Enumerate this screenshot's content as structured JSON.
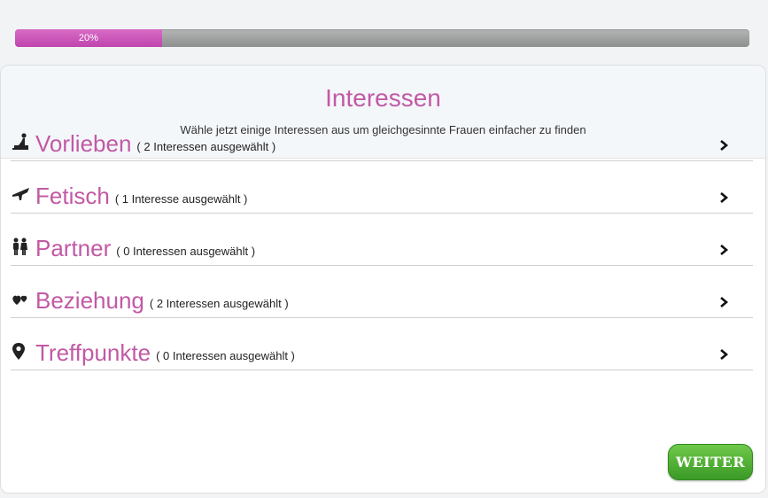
{
  "progress": {
    "value": 0.2,
    "label": "20%",
    "color": "#c655b4"
  },
  "header": {
    "title": "Interessen",
    "subtitle": "Wähle jetzt einige Interessen aus um gleichgesinnte Frauen einfacher zu finden"
  },
  "categories": [
    {
      "icon": "figure-icon",
      "title": "Vorlieben",
      "count": "( 2 Interessen ausgewählt )"
    },
    {
      "icon": "boot-icon",
      "title": "Fetisch",
      "count": "( 1 Interesse ausgewählt )"
    },
    {
      "icon": "couple-icon",
      "title": "Partner",
      "count": "( 0 Interessen ausgewählt )"
    },
    {
      "icon": "hearts-icon",
      "title": "Beziehung",
      "count": "( 2 Interessen ausgewählt )"
    },
    {
      "icon": "map-pin-icon",
      "title": "Treffpunkte",
      "count": "( 0 Interessen ausgewählt )"
    }
  ],
  "actions": {
    "next_label": "WEITER"
  },
  "colors": {
    "accent": "#c259a5",
    "button": "#4caf35"
  }
}
